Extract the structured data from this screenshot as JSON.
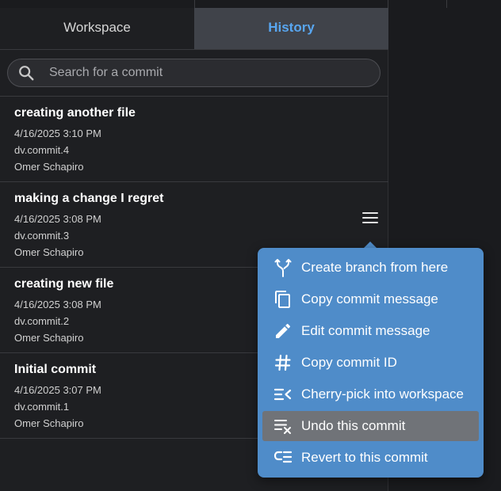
{
  "tabs": {
    "workspace": "Workspace",
    "history": "History"
  },
  "search": {
    "placeholder": "Search for a commit",
    "value": ""
  },
  "commits": [
    {
      "title": "creating another file",
      "date": "4/16/2025 3:10 PM",
      "id": "dv.commit.4",
      "author": "Omer Schapiro"
    },
    {
      "title": "making a change I regret",
      "date": "4/16/2025 3:08 PM",
      "id": "dv.commit.3",
      "author": "Omer Schapiro"
    },
    {
      "title": "creating new file",
      "date": "4/16/2025 3:08 PM",
      "id": "dv.commit.2",
      "author": "Omer Schapiro"
    },
    {
      "title": "Initial commit",
      "date": "4/16/2025 3:07 PM",
      "id": "dv.commit.1",
      "author": "Omer Schapiro"
    }
  ],
  "context_menu": {
    "items": [
      {
        "label": "Create branch from here",
        "icon": "branch-icon"
      },
      {
        "label": "Copy commit message",
        "icon": "copy-icon"
      },
      {
        "label": "Edit commit message",
        "icon": "pencil-icon"
      },
      {
        "label": "Copy commit ID",
        "icon": "hash-icon"
      },
      {
        "label": "Cherry-pick into workspace",
        "icon": "cherry-pick-icon"
      },
      {
        "label": "Undo this commit",
        "icon": "undo-commit-icon",
        "highlighted": true
      },
      {
        "label": "Revert to this commit",
        "icon": "revert-icon"
      }
    ]
  },
  "colors": {
    "background": "#1e1f22",
    "tab_active_bg": "#40434a",
    "tab_active_text": "#58a6f0",
    "menu_bg": "#4f8cc9",
    "menu_highlight": "#707378"
  }
}
